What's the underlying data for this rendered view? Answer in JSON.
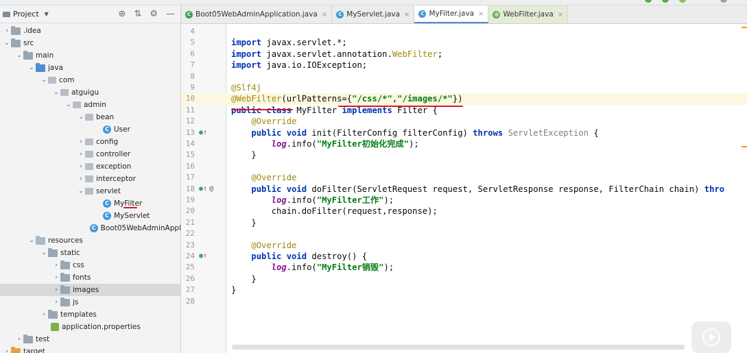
{
  "project_panel": {
    "title": "Project",
    "tree": [
      {
        "label": ".idea",
        "arrow": "›",
        "icon": "folder"
      },
      {
        "label": "src",
        "arrow": "⌄",
        "icon": "folder"
      },
      {
        "label": "main",
        "arrow": "⌄",
        "icon": "folder"
      },
      {
        "label": "java",
        "arrow": "⌄",
        "icon": "folder-blue"
      },
      {
        "label": "com",
        "arrow": "⌄",
        "icon": "package"
      },
      {
        "label": "atguigu",
        "arrow": "⌄",
        "icon": "package"
      },
      {
        "label": "admin",
        "arrow": "⌄",
        "icon": "package"
      },
      {
        "label": "bean",
        "arrow": "⌄",
        "icon": "package"
      },
      {
        "label": "User",
        "arrow": "",
        "icon": "class"
      },
      {
        "label": "config",
        "arrow": "›",
        "icon": "package"
      },
      {
        "label": "controller",
        "arrow": "›",
        "icon": "package"
      },
      {
        "label": "exception",
        "arrow": "›",
        "icon": "package"
      },
      {
        "label": "interceptor",
        "arrow": "›",
        "icon": "package"
      },
      {
        "label": "servlet",
        "arrow": "⌄",
        "icon": "package"
      },
      {
        "label": "MyFilter",
        "arrow": "",
        "icon": "class"
      },
      {
        "label": "MyServlet",
        "arrow": "",
        "icon": "class"
      },
      {
        "label": "Boot05WebAdminAppl",
        "arrow": "",
        "icon": "class"
      },
      {
        "label": "resources",
        "arrow": "⌄",
        "icon": "folder-res"
      },
      {
        "label": "static",
        "arrow": "⌄",
        "icon": "folder"
      },
      {
        "label": "css",
        "arrow": "›",
        "icon": "folder"
      },
      {
        "label": "fonts",
        "arrow": "›",
        "icon": "folder"
      },
      {
        "label": "images",
        "arrow": "›",
        "icon": "folder"
      },
      {
        "label": "js",
        "arrow": "›",
        "icon": "folder"
      },
      {
        "label": "templates",
        "arrow": "›",
        "icon": "folder"
      },
      {
        "label": "application.properties",
        "arrow": "",
        "icon": "properties"
      },
      {
        "label": "test",
        "arrow": "›",
        "icon": "folder"
      },
      {
        "label": "target",
        "arrow": "›",
        "icon": "folder-orange"
      }
    ]
  },
  "tabs": [
    {
      "label": "Boot05WebAdminApplication.java",
      "icon": "boot"
    },
    {
      "label": "MyServlet.java",
      "icon": "class"
    },
    {
      "label": "MyFilter.java",
      "icon": "class"
    },
    {
      "label": "WebFilter.java",
      "icon": "annotation"
    }
  ],
  "code_lines": [
    {
      "n": "4",
      "html": ""
    },
    {
      "n": "5",
      "html": "<span class=\"kw\">import</span> javax.servlet.*;"
    },
    {
      "n": "6",
      "html": "<span class=\"kw\">import</span> javax.servlet.annotation.<span class=\"ann\">WebFilter</span>;"
    },
    {
      "n": "7",
      "html": "<span class=\"kw\">import</span> java.io.IOException;"
    },
    {
      "n": "8",
      "html": ""
    },
    {
      "n": "9",
      "html": "<span class=\"ann\">@Slf4j</span>"
    },
    {
      "n": "10",
      "html": "<span class=\"ann\">@WebFilter</span>(urlPatterns={<span class=\"str\">\"/css/*\"</span>,<span class=\"str\">\"/images/*\"</span>})"
    },
    {
      "n": "11",
      "html": "<span class=\"kw\">public class</span> MyFilter <span class=\"kw\">implements</span> Filter {"
    },
    {
      "n": "12",
      "html": "    <span class=\"ann\">@Override</span>"
    },
    {
      "n": "13",
      "html": "    <span class=\"kw\">public void</span> init(FilterConfig filterConfig) <span class=\"kw\">throws</span> <span class=\"gray\">ServletException</span> {"
    },
    {
      "n": "14",
      "html": "        <span class=\"fld\">log</span>.info(<span class=\"str\">\"MyFilter初始化完成\"</span>);"
    },
    {
      "n": "15",
      "html": "    }"
    },
    {
      "n": "16",
      "html": ""
    },
    {
      "n": "17",
      "html": "    <span class=\"ann\">@Override</span>"
    },
    {
      "n": "18",
      "html": "    <span class=\"kw\">public void</span> doFilter(ServletRequest request, ServletResponse response, FilterChain chain) <span class=\"kw\">thro</span>"
    },
    {
      "n": "19",
      "html": "        <span class=\"fld\">log</span>.info(<span class=\"str\">\"MyFilter工作\"</span>);"
    },
    {
      "n": "20",
      "html": "        chain.doFilter(request,response);"
    },
    {
      "n": "21",
      "html": "    }"
    },
    {
      "n": "22",
      "html": ""
    },
    {
      "n": "23",
      "html": "    <span class=\"ann\">@Override</span>"
    },
    {
      "n": "24",
      "html": "    <span class=\"kw\">public void</span> destroy() {"
    },
    {
      "n": "25",
      "html": "        <span class=\"fld\">log</span>.info(<span class=\"str\">\"MyFilter销毁\"</span>);"
    },
    {
      "n": "26",
      "html": "    }"
    },
    {
      "n": "27",
      "html": "}"
    },
    {
      "n": "28",
      "html": ""
    }
  ],
  "gutter_marks": {
    "13": "override",
    "18": "override-at",
    "24": "override"
  },
  "current_line": "10",
  "colors": {
    "keyword": "#0033b3",
    "annotation": "#9e880d",
    "string": "#067d17",
    "field": "#871094",
    "underline": "#e0161b",
    "active_tab": "#4a89dc"
  }
}
